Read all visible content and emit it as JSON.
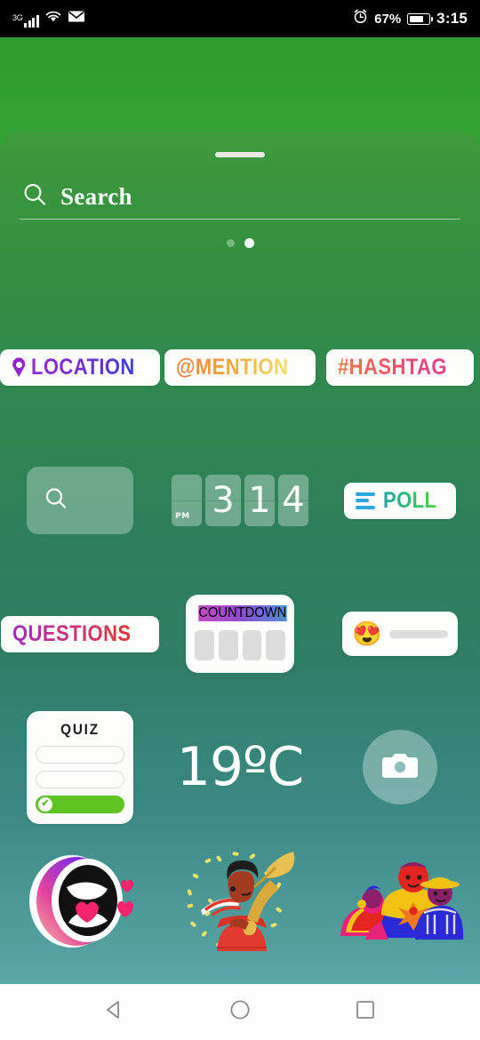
{
  "status_bar": {
    "network_type": "3G",
    "signal_icon": "signal-bars-icon",
    "wifi_icon": "wifi-icon",
    "mail_icon": "mail-icon",
    "alarm_icon": "alarm-clock-icon",
    "battery_percent": "67%",
    "battery_icon": "battery-icon",
    "time": "3:15"
  },
  "sheet": {
    "grabber": "drag-handle",
    "search": {
      "icon": "search-icon",
      "placeholder": "Search",
      "value": ""
    },
    "pagination": {
      "total": 2,
      "active_index": 1
    }
  },
  "stickers": {
    "location": {
      "label": "LOCATION",
      "icon": "location-pin-icon",
      "color_start": "#8f2fd0",
      "color_end": "#3d3fd6"
    },
    "mention": {
      "label": "@MENTION",
      "color_start": "#f07b38",
      "color_end": "#f3e06b"
    },
    "hashtag": {
      "label": "#HASHTAG",
      "color_start": "#f2784b",
      "color_end": "#e0408f"
    },
    "gif": {
      "label": "",
      "icon": "search-icon",
      "name": "gif-search-box"
    },
    "clock": {
      "ampm": "PM",
      "hour": "3",
      "minute_tens": "1",
      "minute_ones": "4"
    },
    "poll": {
      "label": "POLL",
      "icon": "poll-bars-icon",
      "color_start": "#1fa5a0",
      "color_end": "#4fd23f"
    },
    "questions": {
      "label": "QUESTIONS",
      "color_start": "#a02ec0",
      "color_end": "#e03535"
    },
    "countdown": {
      "label": "COUNTDOWN",
      "boxes": 4,
      "color_start": "#c648c6",
      "color_end": "#4b8fd8"
    },
    "emoji_slider": {
      "emoji": "😍",
      "icon": "emoji-slider-icon",
      "fill_percent": 0
    },
    "quiz": {
      "label": "QUIZ",
      "options": [
        "",
        "",
        ""
      ],
      "correct_index": 2,
      "correct_color": "#5fc323",
      "check_icon": "check-icon"
    },
    "temperature": {
      "label": "19ºC",
      "value": "19",
      "unit": "ºC"
    },
    "camera": {
      "icon": "camera-icon"
    },
    "art_shout": {
      "name": "shouting-mouth-hearts-sticker"
    },
    "art_trumpet": {
      "name": "trumpet-player-confetti-sticker"
    },
    "art_family": {
      "name": "three-people-celebration-sticker"
    }
  },
  "nav_bar": {
    "back": "back-triangle-icon",
    "home": "home-circle-icon",
    "recents": "recents-square-icon"
  }
}
